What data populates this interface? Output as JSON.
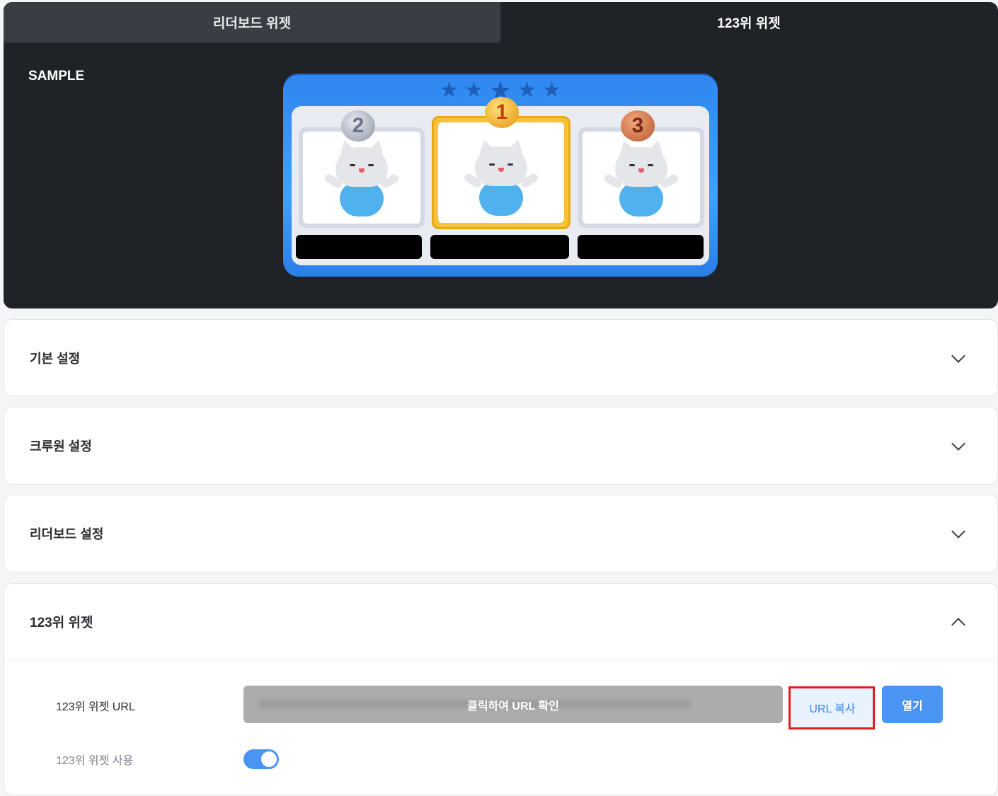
{
  "tabs": [
    {
      "label": "리더보드 위젯",
      "active": false
    },
    {
      "label": "123위 위젯",
      "active": true
    }
  ],
  "preview": {
    "sample_label": "SAMPLE",
    "ranks": [
      "2",
      "1",
      "3"
    ]
  },
  "sections": [
    {
      "title": "기본 설정",
      "expanded": false
    },
    {
      "title": "크루원 설정",
      "expanded": false
    },
    {
      "title": "리더보드 설정",
      "expanded": false
    },
    {
      "title": "123위 위젯",
      "expanded": true
    }
  ],
  "widget_settings": {
    "url_label": "123위 위젯 URL",
    "url_hint": "클릭하여 URL 확인",
    "copy_button": "URL 복사",
    "open_button": "열기",
    "enable_label": "123위 위젯 사용",
    "enabled": true
  },
  "colors": {
    "accent": "#4a94f3",
    "highlight_box": "#e21b1b"
  }
}
